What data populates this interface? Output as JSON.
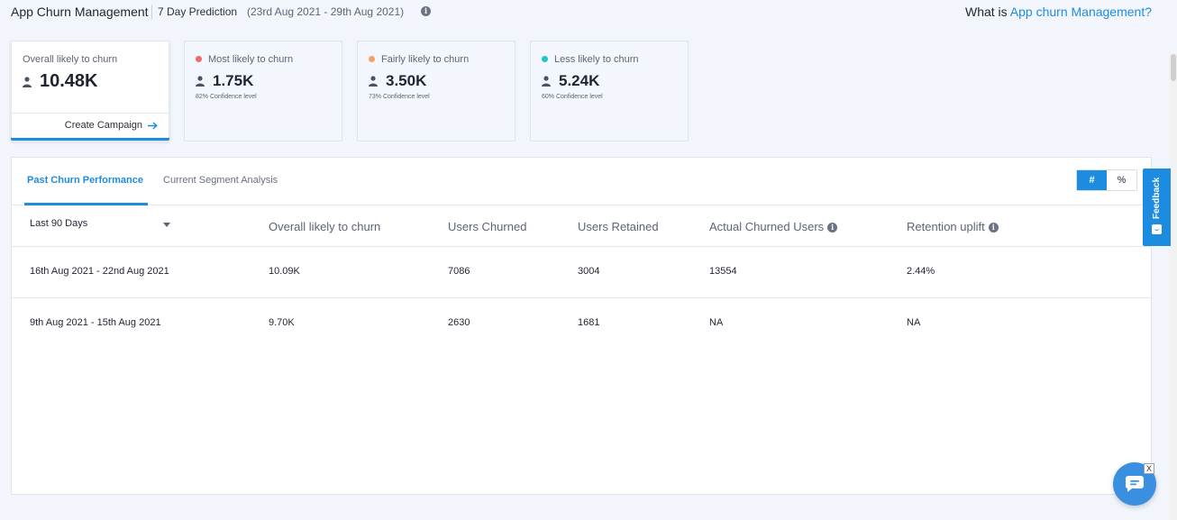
{
  "header": {
    "title": "App Churn Management",
    "prediction_label": "7 Day Prediction",
    "date_range": "(23rd Aug 2021 - 29th Aug 2021)",
    "info": "i",
    "what_is_prefix": "What is ",
    "what_is_link": "App churn Management?"
  },
  "cards": [
    {
      "label": "Overall likely to churn",
      "value": "10.48K",
      "cta": "Create Campaign"
    },
    {
      "label": "Most likely to churn",
      "value": "1.75K",
      "confidence": "82% Confidence level",
      "dot_color": "#ef6b6b"
    },
    {
      "label": "Fairly likely to churn",
      "value": "3.50K",
      "confidence": "73% Confidence level",
      "dot_color": "#f4a066"
    },
    {
      "label": "Less likely to churn",
      "value": "5.24K",
      "confidence": "60% Confidence level",
      "dot_color": "#1fc4c4"
    }
  ],
  "tabs": {
    "active": "Past Churn Performance",
    "inactive": "Current Segment Analysis"
  },
  "toggle": {
    "count": "#",
    "percent": "%"
  },
  "table": {
    "period": "Last 90 Days",
    "headers": [
      "Overall likely to churn",
      "Users Churned",
      "Users Retained",
      "Actual Churned Users",
      "Retention uplift"
    ],
    "rows": [
      [
        "16th Aug 2021 - 22nd Aug 2021",
        "10.09K",
        "7086",
        "3004",
        "13554",
        "2.44%"
      ],
      [
        "9th Aug 2021 - 15th Aug 2021",
        "9.70K",
        "2630",
        "1681",
        "NA",
        "NA"
      ]
    ]
  },
  "feedback": "Feedback",
  "chat_close": "X",
  "colors": {
    "accent": "#1d8ce0"
  }
}
